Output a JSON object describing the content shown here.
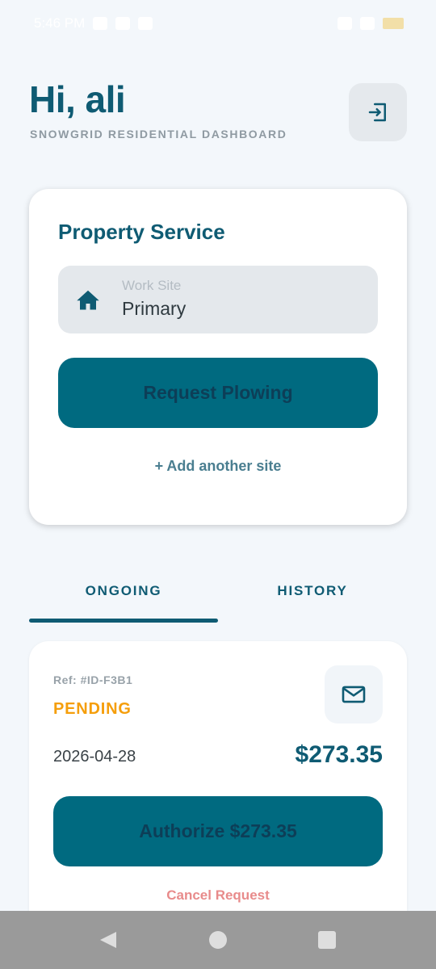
{
  "status_bar": {
    "time": "5:46 PM",
    "icons": [
      "notification-icon",
      "image-icon",
      "message-icon",
      "wifi-icon",
      "signal-icon",
      "battery-icon"
    ]
  },
  "header": {
    "greeting": "Hi, ali",
    "subtitle": "SNOWGRID RESIDENTIAL DASHBOARD",
    "logout_icon": "logout-icon"
  },
  "property_service": {
    "title": "Property Service",
    "work_site": {
      "label": "Work Site",
      "value": "Primary",
      "icon": "home-icon"
    },
    "request_button_label": "Request Plowing",
    "add_site_label": "+ Add another site"
  },
  "tabs": [
    {
      "label": "ONGOING",
      "selected": true
    },
    {
      "label": "HISTORY",
      "selected": false
    }
  ],
  "request_card": {
    "ref": "Ref: #ID-F3B1",
    "status": "PENDING",
    "date": "2026-04-28",
    "price": "$273.35",
    "authorize_label": "Authorize $273.35",
    "cancel_label": "Cancel Request",
    "message_icon": "mail-icon"
  },
  "colors": {
    "primary": "#0f5b73",
    "button": "#006a80",
    "pending": "#f59e0b",
    "cancel": "#e88b8b",
    "background": "#f3f7fb"
  },
  "nav_bar": {
    "icons": [
      "back-icon",
      "home-circle-icon",
      "recents-icon"
    ]
  }
}
